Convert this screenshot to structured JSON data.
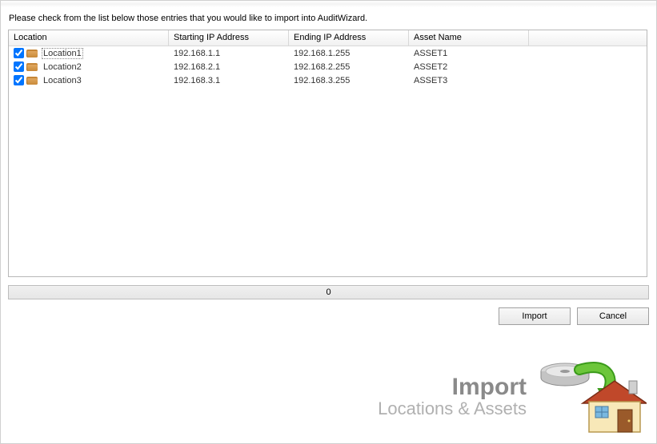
{
  "instruction": "Please check from the list below those entries that you would like to import into AuditWizard.",
  "columns": {
    "location": "Location",
    "startingIp": "Starting IP Address",
    "endingIp": "Ending IP Address",
    "assetName": "Asset Name"
  },
  "rows": [
    {
      "checked": true,
      "location": "Location1",
      "startingIp": "192.168.1.1",
      "endingIp": "192.168.1.255",
      "assetName": "ASSET1",
      "focused": true
    },
    {
      "checked": true,
      "location": "Location2",
      "startingIp": "192.168.2.1",
      "endingIp": "192.168.2.255",
      "assetName": "ASSET2",
      "focused": false
    },
    {
      "checked": true,
      "location": "Location3",
      "startingIp": "192.168.3.1",
      "endingIp": "192.168.3.255",
      "assetName": "ASSET3",
      "focused": false
    }
  ],
  "progress": {
    "value": "0"
  },
  "buttons": {
    "import": "Import",
    "cancel": "Cancel"
  },
  "footer": {
    "title": "Import",
    "subtitle": "Locations & Assets"
  }
}
